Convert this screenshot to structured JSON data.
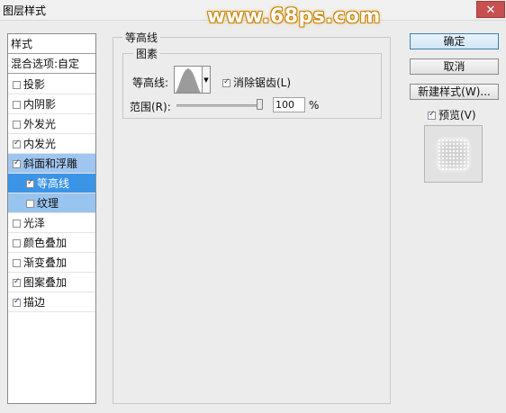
{
  "window": {
    "title": "图层样式",
    "watermark": "www.68ps.com",
    "close_label": "✕"
  },
  "styles_panel": {
    "header": "样式",
    "blend_options": "混合选项:自定",
    "items": [
      {
        "label": "投影",
        "checked": false
      },
      {
        "label": "内阴影",
        "checked": false
      },
      {
        "label": "外发光",
        "checked": false
      },
      {
        "label": "内发光",
        "checked": true
      },
      {
        "label": "斜面和浮雕",
        "checked": true,
        "selected": true
      },
      {
        "label": "等高线",
        "checked": true,
        "sub": true,
        "active": true
      },
      {
        "label": "纹理",
        "checked": false,
        "sub": true
      },
      {
        "label": "光泽",
        "checked": false
      },
      {
        "label": "颜色叠加",
        "checked": false
      },
      {
        "label": "渐变叠加",
        "checked": false
      },
      {
        "label": "图案叠加",
        "checked": true
      },
      {
        "label": "描边",
        "checked": true
      }
    ]
  },
  "contour_section": {
    "group_title": "等高线",
    "sub_group_title": "图素",
    "contour_label": "等高线:",
    "anti_alias_label": "消除锯齿(L)",
    "anti_alias_checked": true,
    "range_label": "范围(R):",
    "range_value": "100",
    "range_unit": "%",
    "range_fraction": 1.0
  },
  "buttons": {
    "ok": "确定",
    "cancel": "取消",
    "new_style": "新建样式(W)...",
    "preview_label": "预览(V)",
    "preview_checked": true
  }
}
